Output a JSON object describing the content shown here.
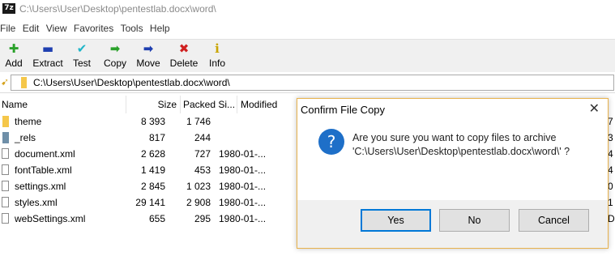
{
  "window": {
    "title": "C:\\Users\\User\\Desktop\\pentestlab.docx\\word\\",
    "app_icon_text": "7z"
  },
  "menu": [
    "File",
    "Edit",
    "View",
    "Favorites",
    "Tools",
    "Help"
  ],
  "toolbar": [
    {
      "label": "Add",
      "icon": "add-icon",
      "glyph": "✚",
      "color": "#2aa12a"
    },
    {
      "label": "Extract",
      "icon": "extract-icon",
      "glyph": "▬",
      "color": "#1f3fb0"
    },
    {
      "label": "Test",
      "icon": "test-icon",
      "glyph": "✔",
      "color": "#1fb5c8"
    },
    {
      "label": "Copy",
      "icon": "copy-icon",
      "glyph": "➡",
      "color": "#2aa12a"
    },
    {
      "label": "Move",
      "icon": "move-icon",
      "glyph": "➡",
      "color": "#1f3fb0"
    },
    {
      "label": "Delete",
      "icon": "delete-icon",
      "glyph": "✖",
      "color": "#d02020"
    },
    {
      "label": "Info",
      "icon": "info-icon",
      "glyph": "i",
      "color": "#c9a500"
    }
  ],
  "address": {
    "path": "C:\\Users\\User\\Desktop\\pentestlab.docx\\word\\"
  },
  "columns": {
    "name": "Name",
    "size": "Size",
    "packed": "Packed Si...",
    "modified": "Modified"
  },
  "files": [
    {
      "name": "theme",
      "type": "folder",
      "size": "8 393",
      "packed": "1 746",
      "modified": "",
      "edge": "7"
    },
    {
      "name": "_rels",
      "type": "folder-grey",
      "size": "817",
      "packed": "244",
      "modified": "",
      "edge": "3"
    },
    {
      "name": "document.xml",
      "type": "file",
      "size": "2 628",
      "packed": "727",
      "modified": "1980-01-...",
      "edge": "4"
    },
    {
      "name": "fontTable.xml",
      "type": "file",
      "size": "1 419",
      "packed": "453",
      "modified": "1980-01-...",
      "edge": "4"
    },
    {
      "name": "settings.xml",
      "type": "file",
      "size": "2 845",
      "packed": "1 023",
      "modified": "1980-01-...",
      "edge": "0"
    },
    {
      "name": "styles.xml",
      "type": "file",
      "size": "29 141",
      "packed": "2 908",
      "modified": "1980-01-...",
      "edge": "1"
    },
    {
      "name": "webSettings.xml",
      "type": "file",
      "size": "655",
      "packed": "295",
      "modified": "1980-01-...",
      "edge": "D"
    }
  ],
  "dialog": {
    "title": "Confirm File Copy",
    "close": "✕",
    "icon_glyph": "?",
    "message_line1": "Are you sure you want to copy files to archive",
    "message_line2": "'C:\\Users\\User\\Desktop\\pentestlab.docx\\word\\' ?",
    "buttons": {
      "yes": "Yes",
      "no": "No",
      "cancel": "Cancel"
    }
  }
}
